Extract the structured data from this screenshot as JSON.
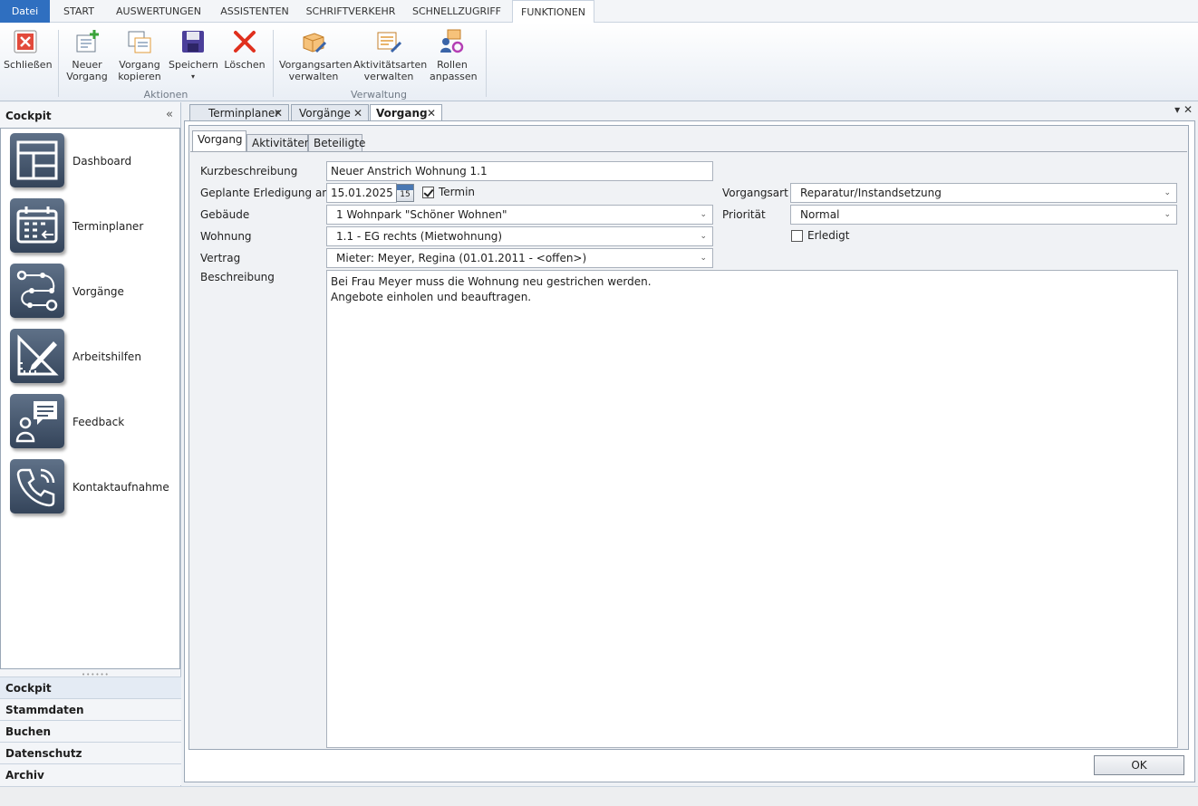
{
  "ribbon_tabs": [
    "Datei",
    "START",
    "AUSWERTUNGEN",
    "ASSISTENTEN",
    "SCHRIFTVERKEHR",
    "SCHNELLZUGRIFF",
    "FUNKTIONEN"
  ],
  "ribbon": {
    "close": "Schließen",
    "new_case": "Neuer\nVorgang",
    "copy_case": "Vorgang\nkopieren",
    "save": "Speichern",
    "delete": "Löschen",
    "manage_case_types": "Vorgangsarten\nverwalten",
    "manage_activity_types": "Aktivitätsarten\nverwalten",
    "adjust_roles": "Rollen\nanpassen",
    "group_actions": "Aktionen",
    "group_admin": "Verwaltung"
  },
  "nav": {
    "header": "Cockpit",
    "items": [
      "Dashboard",
      "Terminplaner",
      "Vorgänge",
      "Arbeitshilfen",
      "Feedback",
      "Kontaktaufnahme"
    ],
    "sections": [
      "Cockpit",
      "Stammdaten",
      "Buchen",
      "Datenschutz",
      "Archiv"
    ]
  },
  "doc_tabs": [
    "Terminplaner",
    "Vorgänge",
    "Vorgang"
  ],
  "sub_tabs": [
    "Vorgang",
    "Aktivitäten",
    "Beteiligte"
  ],
  "form": {
    "short_desc_label": "Kurzbeschreibung",
    "short_desc_value": "Neuer Anstrich Wohnung 1.1",
    "due_label": "Geplante Erledigung am",
    "due_value": "15.01.2025",
    "calendar_day": "15",
    "appointment_label": "Termin",
    "appointment_checked": true,
    "building_label": "Gebäude",
    "building_value": "1 Wohnpark \"Schöner Wohnen\"",
    "flat_label": "Wohnung",
    "flat_value": "1.1 - EG rechts (Mietwohnung)",
    "contract_label": "Vertrag",
    "contract_value": "Mieter: Meyer, Regina (01.01.2011 - <offen>)",
    "type_label": "Vorgangsart",
    "type_value": "Reparatur/Instandsetzung",
    "priority_label": "Priorität",
    "priority_value": "Normal",
    "done_label": "Erledigt",
    "done_checked": false,
    "description_label": "Beschreibung",
    "description_line1": "Bei Frau Meyer muss die Wohnung neu gestrichen werden.",
    "description_line2": "Angebote einholen und beauftragen."
  },
  "ok_label": "OK",
  "colors": {
    "file_tab": "#2f6fc0",
    "tile": "#4a5b71",
    "delete_red": "#e0301e"
  }
}
